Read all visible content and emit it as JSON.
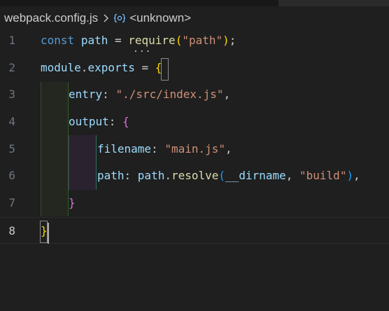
{
  "breadcrumb": {
    "file": "webpack.config.js",
    "symbol": "<unknown>"
  },
  "lines": [
    {
      "number": "1"
    },
    {
      "number": "2"
    },
    {
      "number": "3"
    },
    {
      "number": "4"
    },
    {
      "number": "5"
    },
    {
      "number": "6"
    },
    {
      "number": "7"
    },
    {
      "number": "8"
    }
  ],
  "code": {
    "l1": {
      "kw": "const",
      "name": "path",
      "eq": " = ",
      "fn": "require",
      "open": "(",
      "arg": "\"path\"",
      "close": ")",
      "end": ";"
    },
    "l2": {
      "obj": "module",
      "dot": ".",
      "prop": "exports",
      "eq": " = ",
      "open": "{"
    },
    "l3": {
      "key": "entry",
      "colon": ": ",
      "value": "\"./src/index.js\"",
      "comma": ","
    },
    "l4": {
      "key": "output",
      "colon": ": ",
      "open": "{"
    },
    "l5": {
      "key": "filename",
      "colon": ": ",
      "value": "\"main.js\"",
      "comma": ","
    },
    "l6": {
      "key": "path",
      "colon": ": ",
      "obj": "path",
      "dot": ".",
      "fn": "resolve",
      "open": "(",
      "arg1": "__dirname",
      "sep": ", ",
      "arg2": "\"build\"",
      "close": ")",
      "comma": ","
    },
    "l7": {
      "close": "}"
    },
    "l8": {
      "close": "}"
    }
  },
  "hover_dots": "...",
  "colors": {
    "background": "#1f1f1f",
    "keyword": "#569cd6",
    "variable": "#9cdcfe",
    "function": "#dcdcaa",
    "string": "#ce9178",
    "bracket_level1": "#ffd700",
    "bracket_level2": "#da70d6",
    "bracket_level3": "#179fff"
  },
  "icons": {
    "breadcrumb_separator": "chevron-right-icon",
    "breadcrumb_symbol": "symbol-object-icon"
  }
}
